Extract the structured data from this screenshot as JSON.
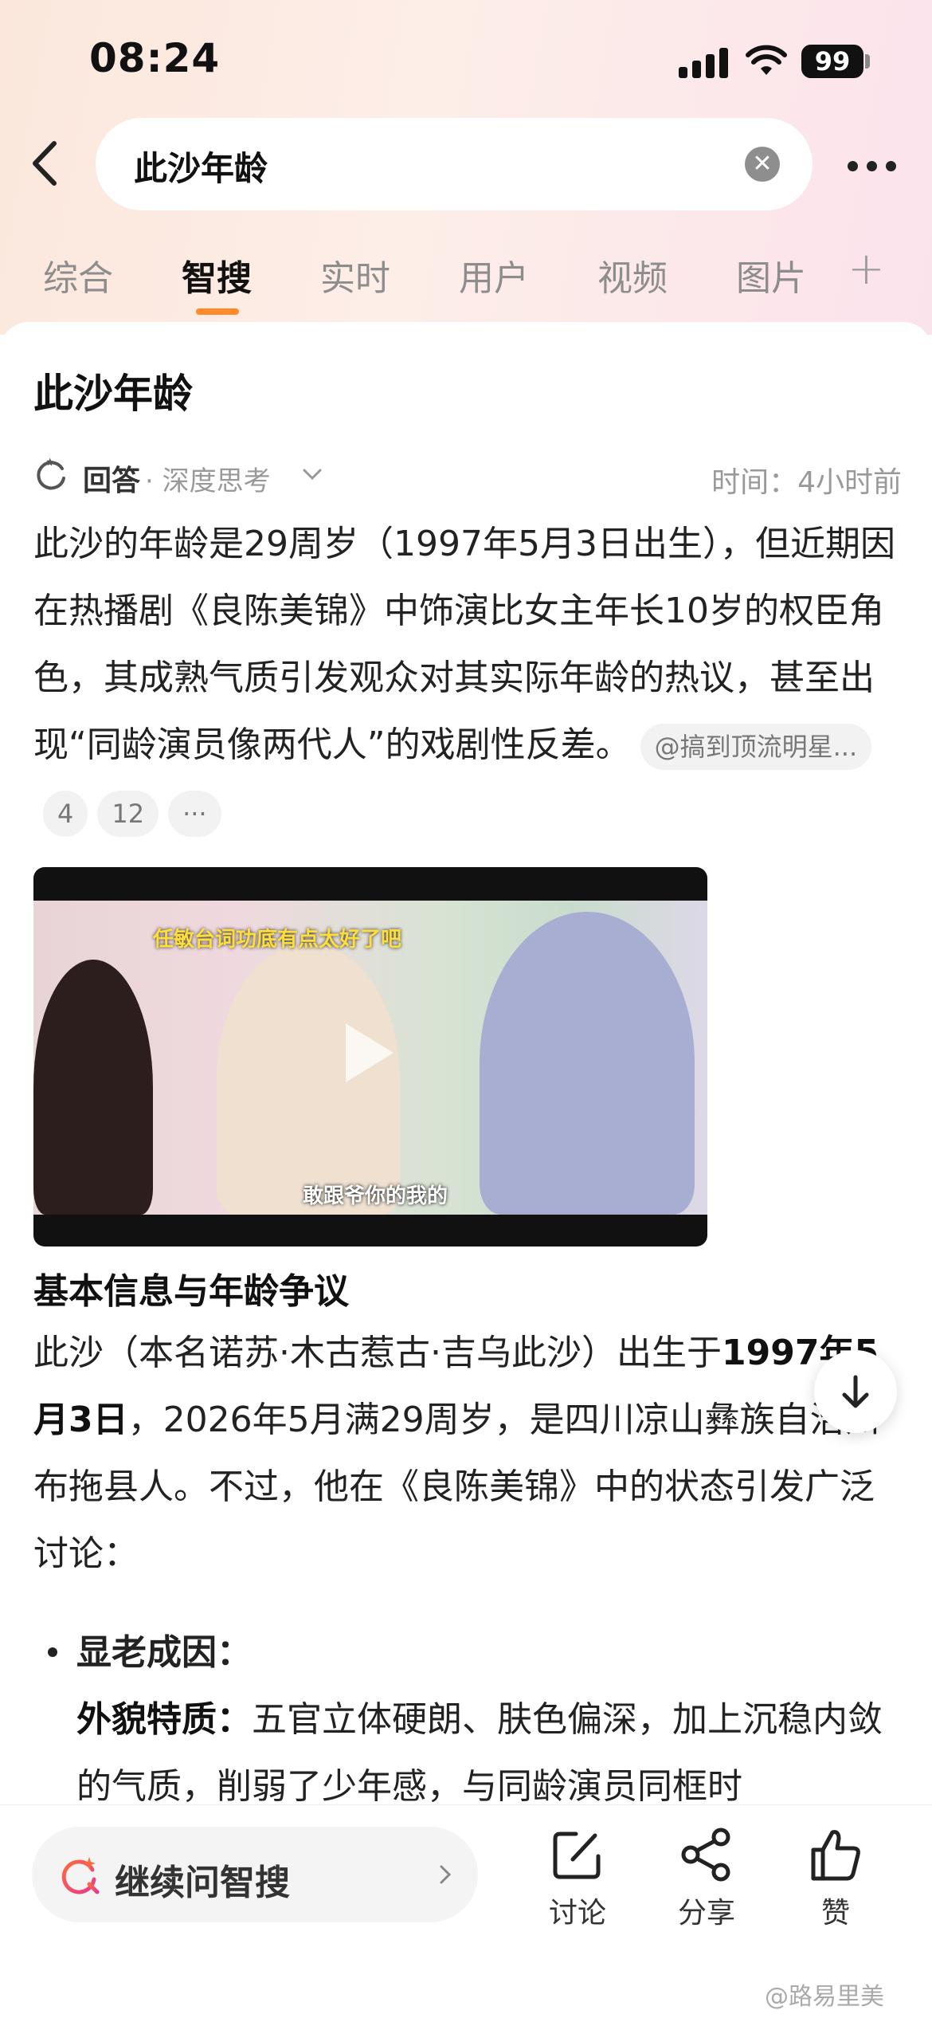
{
  "status_bar": {
    "time": "08:24",
    "battery": "99"
  },
  "search": {
    "query": "此沙年龄"
  },
  "tabs": [
    "综合",
    "智搜",
    "实时",
    "用户",
    "视频",
    "图片"
  ],
  "active_tab": "智搜",
  "card": {
    "title": "此沙年龄",
    "answer_label": "回答",
    "mode_label": "· 深度思考",
    "time_label": "时间：",
    "time_value": "4小时前",
    "intro": "此沙的年龄是29周岁（1997年5月3日出生），但近期因在热播剧《良陈美锦》中饰演比女主年长10岁的权臣角色，其成熟气质引发观众对其实际年龄的热议，甚至出现“同龄演员像两代人”的戏剧性反差。",
    "source_chip": "@搞到顶流明星...",
    "source_count_1": "4",
    "source_count_2": "12",
    "more_chip": "···",
    "video": {
      "caption_top": "任敏台词功底有点太好了吧",
      "caption_bottom": "敢跟爷你的我的"
    },
    "section_heading": "基本信息与年龄争议",
    "para2_a": "此沙（本名诺苏·木古惹古·吉乌此沙）出生于",
    "para2_bold": "1997年5月3日",
    "para2_b": "，2026年5月满29周岁，是四川凉山彝族自治州布拖县人。不过，他在《良陈美锦》中的状态引发广泛讨论：",
    "bullet_title": "显老成因：",
    "sub_label": "外貌特质：",
    "sub_text": "五官立体硬朗、肤色偏深，加上沉稳内敛的气质，削弱了少年感，与同龄演员同框时"
  },
  "bottom_bar": {
    "followup": "继续问智搜",
    "discuss": "讨论",
    "share": "分享",
    "like": "赞"
  },
  "watermark": "@路易里美",
  "colors": {
    "accent": "#ff8a2a",
    "brand_red": "#ff4d4f"
  }
}
